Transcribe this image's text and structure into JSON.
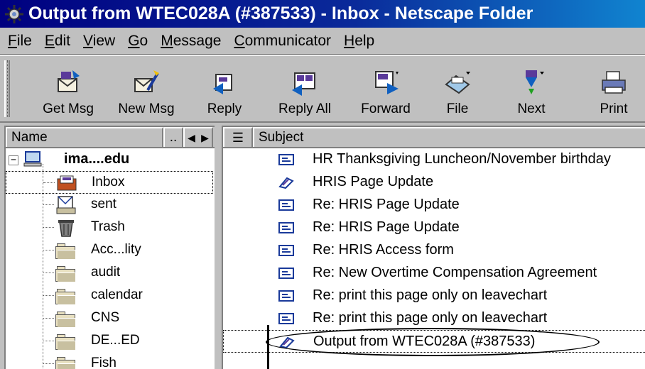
{
  "window": {
    "title": "Output from WTEC028A (#387533) - Inbox - Netscape Folder",
    "icon": "netscape-folder-icon"
  },
  "menubar": {
    "items": [
      "File",
      "Edit",
      "View",
      "Go",
      "Message",
      "Communicator",
      "Help"
    ]
  },
  "toolbar": {
    "buttons": [
      {
        "label": "Get Msg",
        "icon": "get-messages-icon"
      },
      {
        "label": "New Msg",
        "icon": "new-message-icon"
      },
      {
        "label": "Reply",
        "icon": "reply-icon"
      },
      {
        "label": "Reply All",
        "icon": "reply-all-icon"
      },
      {
        "label": "Forward",
        "icon": "forward-icon"
      },
      {
        "label": "File",
        "icon": "file-icon"
      },
      {
        "label": "Next",
        "icon": "next-icon"
      },
      {
        "label": "Print",
        "icon": "print-icon"
      }
    ]
  },
  "folder_pane": {
    "header": {
      "name": "Name",
      "dots": ".."
    },
    "account": "ima....edu",
    "folders": [
      {
        "label": "Inbox",
        "icon": "inbox-icon",
        "selected": true
      },
      {
        "label": "sent",
        "icon": "sent-icon"
      },
      {
        "label": "Trash",
        "icon": "trash-icon"
      },
      {
        "label": "Acc...lity",
        "icon": "folder-icon"
      },
      {
        "label": "audit",
        "icon": "folder-icon"
      },
      {
        "label": "calendar",
        "icon": "folder-icon"
      },
      {
        "label": "CNS",
        "icon": "folder-icon"
      },
      {
        "label": "DE...ED",
        "icon": "folder-icon"
      },
      {
        "label": "Fish",
        "icon": "folder-icon"
      }
    ]
  },
  "message_pane": {
    "header": {
      "subject": "Subject"
    },
    "messages": [
      {
        "subject": "HR Thanksgiving Luncheon/November birthday",
        "icon": "message-icon"
      },
      {
        "subject": "HRIS Page Update",
        "icon": "attachment-message-icon"
      },
      {
        "subject": "Re: HRIS Page Update",
        "icon": "message-icon"
      },
      {
        "subject": "Re: HRIS Page Update",
        "icon": "message-icon"
      },
      {
        "subject": "Re: HRIS Access form",
        "icon": "message-icon"
      },
      {
        "subject": "Re: New Overtime Compensation Agreement",
        "icon": "message-icon"
      },
      {
        "subject": "Re: print this page only on leavechart",
        "icon": "message-icon"
      },
      {
        "subject": "Re: print this page only on leavechart",
        "icon": "message-icon"
      },
      {
        "subject": "Output from WTEC028A (#387533)",
        "icon": "attachment-message-icon",
        "selected": true
      }
    ]
  },
  "colors": {
    "title_bar_start": "#000080",
    "title_bar_end": "#1084d0",
    "chrome": "#c0c0c0"
  }
}
